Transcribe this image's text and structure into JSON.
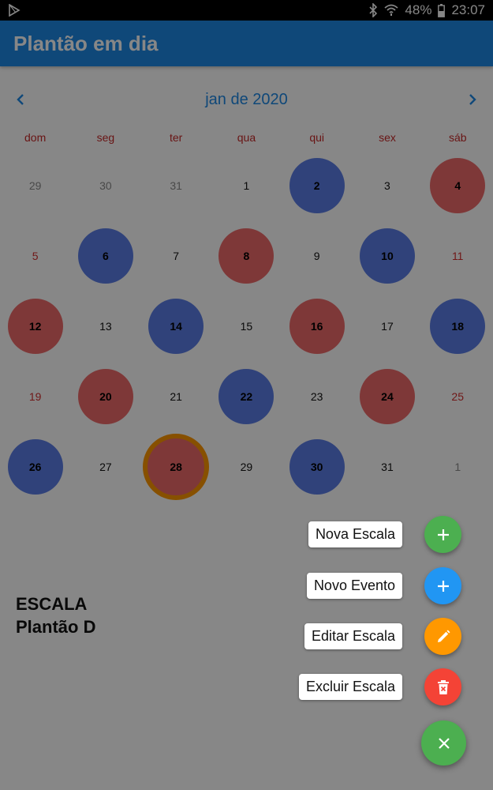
{
  "status_bar": {
    "battery": "48%",
    "time": "23:07",
    "icons": [
      "play-store-icon",
      "bluetooth-icon",
      "wifi-icon",
      "battery-icon"
    ]
  },
  "app": {
    "title": "Plantão em dia",
    "accent": "#1e88e5"
  },
  "calendar": {
    "month_label": "jan de 2020",
    "weekdays": [
      "dom",
      "seg",
      "ter",
      "qua",
      "qui",
      "sex",
      "sáb"
    ],
    "weeks": [
      [
        {
          "d": "29",
          "kind": "outside"
        },
        {
          "d": "30",
          "kind": "outside"
        },
        {
          "d": "31",
          "kind": "outside"
        },
        {
          "d": "1",
          "kind": "normal"
        },
        {
          "d": "2",
          "kind": "blue"
        },
        {
          "d": "3",
          "kind": "normal"
        },
        {
          "d": "4",
          "kind": "red"
        }
      ],
      [
        {
          "d": "5",
          "kind": "weekend"
        },
        {
          "d": "6",
          "kind": "blue"
        },
        {
          "d": "7",
          "kind": "normal"
        },
        {
          "d": "8",
          "kind": "red"
        },
        {
          "d": "9",
          "kind": "normal"
        },
        {
          "d": "10",
          "kind": "blue"
        },
        {
          "d": "11",
          "kind": "weekend"
        }
      ],
      [
        {
          "d": "12",
          "kind": "red"
        },
        {
          "d": "13",
          "kind": "normal"
        },
        {
          "d": "14",
          "kind": "blue"
        },
        {
          "d": "15",
          "kind": "normal"
        },
        {
          "d": "16",
          "kind": "red"
        },
        {
          "d": "17",
          "kind": "normal"
        },
        {
          "d": "18",
          "kind": "blue"
        }
      ],
      [
        {
          "d": "19",
          "kind": "weekend"
        },
        {
          "d": "20",
          "kind": "red"
        },
        {
          "d": "21",
          "kind": "normal"
        },
        {
          "d": "22",
          "kind": "blue"
        },
        {
          "d": "23",
          "kind": "normal"
        },
        {
          "d": "24",
          "kind": "red"
        },
        {
          "d": "25",
          "kind": "weekend"
        }
      ],
      [
        {
          "d": "26",
          "kind": "blue"
        },
        {
          "d": "27",
          "kind": "normal"
        },
        {
          "d": "28",
          "kind": "today"
        },
        {
          "d": "29",
          "kind": "normal"
        },
        {
          "d": "30",
          "kind": "blue"
        },
        {
          "d": "31",
          "kind": "normal"
        },
        {
          "d": "1",
          "kind": "outside"
        }
      ]
    ],
    "colors": {
      "blue_shift": "#5c7ee6",
      "red_shift": "#ef6b6b",
      "today_ring": "#ff9800",
      "weekend_text": "#d32f2f"
    }
  },
  "event": {
    "line1": "ESCALA",
    "line2": "Plantão D"
  },
  "fab_menu": {
    "items": [
      {
        "label": "Nova Escala",
        "icon": "plus-icon",
        "color": "#4caf50"
      },
      {
        "label": "Novo Evento",
        "icon": "plus-icon",
        "color": "#2196f3"
      },
      {
        "label": "Editar Escala",
        "icon": "pencil-icon",
        "color": "#ff9800"
      },
      {
        "label": "Excluir Escala",
        "icon": "trash-icon",
        "color": "#f44336"
      }
    ],
    "main": {
      "icon": "close-icon",
      "color": "#4caf50"
    }
  }
}
